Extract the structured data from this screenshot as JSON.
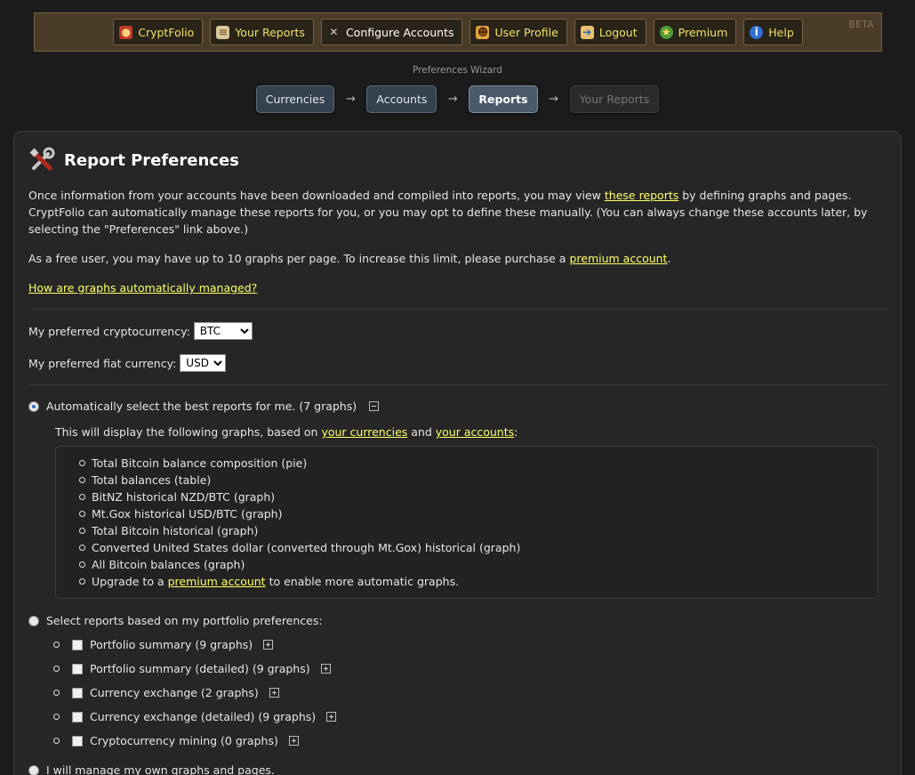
{
  "nav": {
    "items": [
      {
        "label": "CryptFolio",
        "icon": "coin-icon",
        "color": "#d04a2a"
      },
      {
        "label": "Your Reports",
        "icon": "document-icon",
        "color": "#c8b07a"
      },
      {
        "label": "Configure Accounts",
        "icon": "tools-icon",
        "color": "#999999"
      },
      {
        "label": "User Profile",
        "icon": "user-icon",
        "color": "#e2a340"
      },
      {
        "label": "Logout",
        "icon": "logout-icon",
        "color": "#3aa0e0"
      },
      {
        "label": "Premium",
        "icon": "star-icon",
        "color": "#4e9a3a"
      },
      {
        "label": "Help",
        "icon": "info-icon",
        "color": "#2f6fd0"
      }
    ],
    "active_index": 2,
    "beta": "BETA"
  },
  "wizard": {
    "title": "Preferences Wizard",
    "steps": [
      "Currencies",
      "Accounts",
      "Reports",
      "Your Reports"
    ],
    "arrow": "→"
  },
  "page": {
    "title": "Report Preferences",
    "intro_before": "Once information from your accounts have been downloaded and compiled into reports, you may view ",
    "intro_link": "these reports",
    "intro_after": " by defining graphs and pages. CryptFolio can automatically manage these reports for you, or you may opt to define these manually. (You can always change these accounts later, by selecting the \"Preferences\" link above.)",
    "limit_before": "As a free user, you may have up to 10 graphs per page. To increase this limit, please purchase a ",
    "limit_link": "premium account",
    "limit_after": ".",
    "how_link": "How are graphs automatically managed?",
    "crypto_label": "My preferred cryptocurrency:",
    "crypto_value": "BTC",
    "fiat_label": "My preferred fiat currency:",
    "fiat_value": "USD",
    "auto": {
      "label": "Automatically select the best reports for me. (7 graphs)",
      "desc_before": "This will display the following graphs, based on ",
      "desc_link1": "your currencies",
      "desc_mid": " and ",
      "desc_link2": "your accounts",
      "desc_after": ":",
      "graphs": [
        "Total Bitcoin balance composition (pie)",
        "Total balances (table)",
        "BitNZ historical NZD/BTC (graph)",
        "Mt.Gox historical USD/BTC (graph)",
        "Total Bitcoin historical (graph)",
        "Converted United States dollar (converted through Mt.Gox) historical (graph)",
        "All Bitcoin balances (graph)"
      ],
      "upgrade_before": "Upgrade to a ",
      "upgrade_link": "premium account",
      "upgrade_after": " to enable more automatic graphs."
    },
    "portfolio": {
      "label": "Select reports based on my portfolio preferences:",
      "items": [
        "Portfolio summary (9 graphs)",
        "Portfolio summary (detailed) (9 graphs)",
        "Currency exchange (2 graphs)",
        "Currency exchange (detailed) (9 graphs)",
        "Cryptocurrency mining (0 graphs)"
      ]
    },
    "manual": {
      "label": "I will manage my own graphs and pages."
    }
  }
}
